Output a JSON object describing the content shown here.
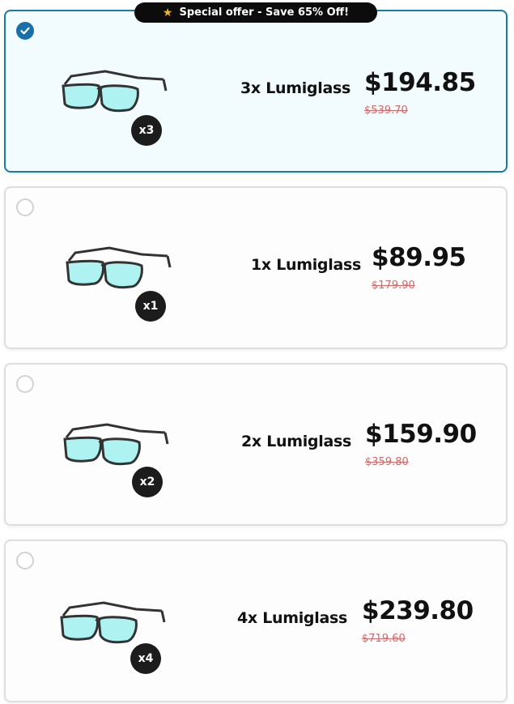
{
  "offer_badge": {
    "star": "★",
    "text": "Special offer - Save 65% Off!"
  },
  "colors": {
    "accent": "#1b7aa0",
    "check": "#1a6fa8",
    "old_price": "#d06a6a",
    "lens": "#aef3f1"
  },
  "options": [
    {
      "product": "3x Lumiglass",
      "price": "$194.85",
      "old_price": "$539.70",
      "quantity_badge": "x3",
      "selected": true
    },
    {
      "product": "1x Lumiglass",
      "price": "$89.95",
      "old_price": "$179.90",
      "quantity_badge": "x1",
      "selected": false
    },
    {
      "product": "2x Lumiglass",
      "price": "$159.90",
      "old_price": "$359.80",
      "quantity_badge": "x2",
      "selected": false
    },
    {
      "product": "4x Lumiglass",
      "price": "$239.80",
      "old_price": "$719.60",
      "quantity_badge": "x4",
      "selected": false
    }
  ]
}
